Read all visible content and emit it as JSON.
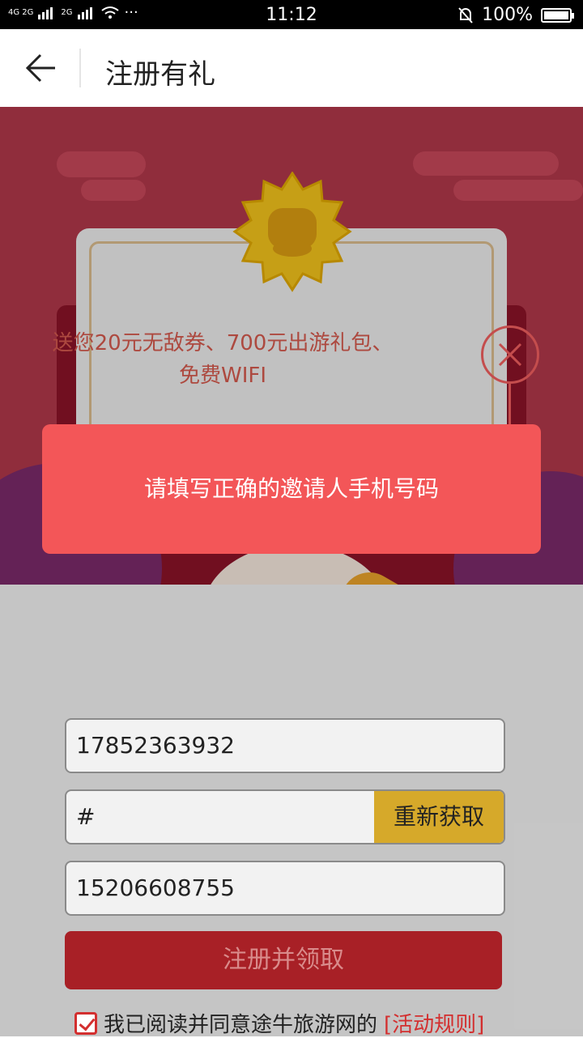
{
  "status_bar": {
    "signal_left": "4G 2G",
    "signal_right": "2G",
    "dots": "···",
    "time": "11:12",
    "battery_percent": "100%"
  },
  "header": {
    "title": "注册有礼"
  },
  "promo": {
    "text": "送您20元无敌券、700元出游礼包、免费WIFI"
  },
  "toast": {
    "message": "请填写正确的邀请人手机号码"
  },
  "form": {
    "phone_value": "17852363932",
    "code_value": "#",
    "resend_label": "重新获取",
    "inviter_value": "15206608755",
    "submit_label": "注册并领取",
    "agree_text": "我已阅读并同意途牛旅游网的",
    "rules_link": "[活动规则]",
    "agree_checked": true
  },
  "colors": {
    "toast_bg": "#f35658",
    "submit_bg": "#a82026",
    "resend_bg": "#d6a92a",
    "accent_red": "#d32f2f"
  }
}
